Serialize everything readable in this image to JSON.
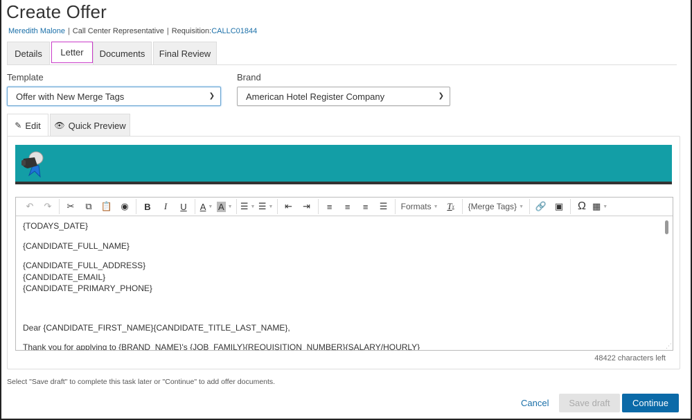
{
  "page": {
    "title": "Create Offer",
    "candidate_name": "Meredith Malone",
    "position": "Call Center Representative",
    "requisition_label": "Requisition:",
    "requisition_id": "CALLC01844",
    "separator": "|"
  },
  "tabs": [
    {
      "label": "Details",
      "active": false
    },
    {
      "label": "Letter",
      "active": true
    },
    {
      "label": "Documents",
      "active": false
    },
    {
      "label": "Final Review",
      "active": false
    }
  ],
  "form": {
    "template_label": "Template",
    "template_value": "Offer with New Merge Tags",
    "brand_label": "Brand",
    "brand_value": "American Hotel Register Company"
  },
  "edit_tabs": [
    {
      "label": "Edit",
      "icon": "edit-icon",
      "active": true
    },
    {
      "label": "Quick Preview",
      "icon": "eye-icon",
      "active": false
    }
  ],
  "banner": {
    "color": "#139ea6",
    "logo": "bell-logo-icon"
  },
  "toolbar": {
    "formats_label": "Formats",
    "merge_tags_label": "{Merge Tags}",
    "buttons": [
      "undo",
      "redo",
      "cut",
      "copy",
      "paste",
      "find",
      "bold",
      "italic",
      "underline",
      "text-color",
      "background-color",
      "bullet-list",
      "numbered-list",
      "outdent",
      "indent",
      "align-left",
      "align-center",
      "align-right",
      "justify",
      "formats",
      "clear-formatting",
      "merge-tags",
      "link",
      "image",
      "special-character",
      "table"
    ]
  },
  "editor": {
    "lines": [
      "{TODAYS_DATE}",
      "{CANDIDATE_FULL_NAME}",
      "{CANDIDATE_FULL_ADDRESS}",
      "{CANDIDATE_EMAIL}",
      "{CANDIDATE_PRIMARY_PHONE}",
      "Dear {CANDIDATE_FIRST_NAME}{CANDIDATE_TITLE_LAST_NAME},",
      "Thank you for applying to {BRAND_NAME}'s {JOB_FAMILY}{REQUISITION_NUMBER}{SALARY/HOURLY}"
    ],
    "chars_left": "48422 characters left"
  },
  "footer": {
    "hint": "Select \"Save draft\" to complete this task later or \"Continue\" to add offer documents.",
    "cancel_label": "Cancel",
    "save_draft_label": "Save draft",
    "continue_label": "Continue"
  },
  "colors": {
    "accent": "#0b6aa8",
    "link": "#1a6fa8",
    "active_tab_outline": "#c93bc9"
  }
}
